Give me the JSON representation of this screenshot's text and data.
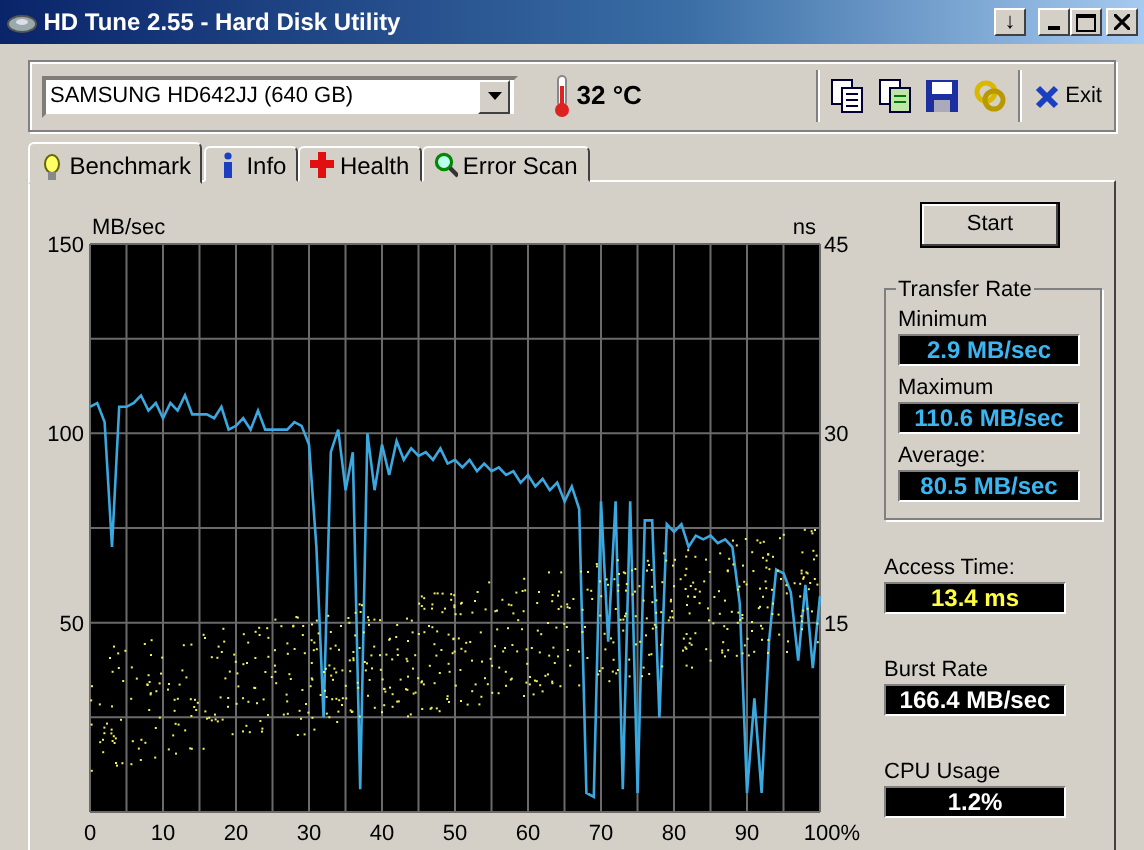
{
  "window": {
    "title": "HD Tune 2.55 - Hard Disk Utility",
    "controls": [
      "↓"
    ]
  },
  "toolbar": {
    "drive": "SAMSUNG HD642JJ (640 GB)",
    "temperature": "32 °C",
    "exit": "Exit"
  },
  "tabs": [
    {
      "label": "Benchmark",
      "selected": true,
      "kind": "bulb"
    },
    {
      "label": "Info",
      "selected": false,
      "kind": "info"
    },
    {
      "label": "Health",
      "selected": false,
      "kind": "cross"
    },
    {
      "label": "Error Scan",
      "selected": false,
      "kind": "search"
    }
  ],
  "benchmark": {
    "chart_data": {
      "type": "line",
      "ylabel": "MB/sec",
      "y2label": "ns",
      "xlim": [
        0,
        100
      ],
      "ylim": [
        0,
        150
      ],
      "y2lim": [
        0,
        45
      ],
      "grid": true,
      "xticks": [
        0,
        10,
        20,
        30,
        40,
        50,
        60,
        70,
        80,
        90,
        {
          "value": 100,
          "label": "100%"
        }
      ],
      "yticks": [
        50,
        100,
        150
      ],
      "y2ticks": [
        15,
        30,
        45
      ],
      "x": [
        0,
        1,
        2,
        3,
        4,
        5,
        6,
        7,
        8,
        9,
        10,
        11,
        12,
        13,
        14,
        15,
        16,
        17,
        18,
        19,
        20,
        21,
        22,
        23,
        24,
        25,
        26,
        27,
        28,
        29,
        30,
        31,
        32,
        33,
        34,
        35,
        36,
        37,
        38,
        39,
        40,
        41,
        42,
        43,
        44,
        45,
        46,
        47,
        48,
        49,
        50,
        51,
        52,
        53,
        54,
        55,
        56,
        57,
        58,
        59,
        60,
        61,
        62,
        63,
        64,
        65,
        66,
        67,
        68,
        69,
        70,
        71,
        72,
        73,
        74,
        75,
        76,
        77,
        78,
        79,
        80,
        81,
        82,
        83,
        84,
        85,
        86,
        87,
        88,
        89,
        90,
        91,
        92,
        93,
        94,
        95,
        96,
        97,
        98,
        99,
        100
      ],
      "series": [
        {
          "color": "#3ba8e0",
          "values": [
            107,
            108,
            103,
            70,
            107,
            107,
            108,
            110,
            106,
            108,
            104,
            108,
            106,
            110,
            105,
            105,
            105,
            104,
            107,
            101,
            102,
            104,
            101,
            106,
            101,
            101,
            101,
            101,
            103,
            102,
            97,
            70,
            25,
            95,
            101,
            85,
            95,
            6,
            100,
            85,
            97,
            89,
            98,
            93,
            96,
            94,
            95,
            93,
            96,
            92,
            93,
            91,
            93,
            90,
            92,
            90,
            91,
            89,
            90,
            87,
            89,
            86,
            88,
            85,
            87,
            82,
            86,
            80,
            5,
            4,
            82,
            45,
            82,
            6,
            82,
            5,
            77,
            77,
            25,
            76,
            74,
            76,
            70,
            73,
            72,
            73,
            71,
            72,
            70,
            55,
            5,
            30,
            5,
            45,
            64,
            63,
            58,
            40,
            60,
            38,
            57
          ]
        }
      ]
    },
    "start": "Start",
    "transfer_rate": {
      "title": "Transfer Rate",
      "items": [
        {
          "label": "Minimum",
          "value": "2.9 MB/sec"
        },
        {
          "label": "Maximum",
          "value": "110.6 MB/sec"
        },
        {
          "label": "Average:",
          "value": "80.5 MB/sec"
        }
      ]
    },
    "stats": [
      {
        "label": "Access Time:",
        "value": "13.4 ms",
        "kind": "latency"
      },
      {
        "label": "Burst Rate",
        "value": "166.4 MB/sec",
        "kind": "throughput"
      },
      {
        "label": "CPU Usage",
        "value": "1.2%",
        "kind": "load"
      }
    ]
  }
}
